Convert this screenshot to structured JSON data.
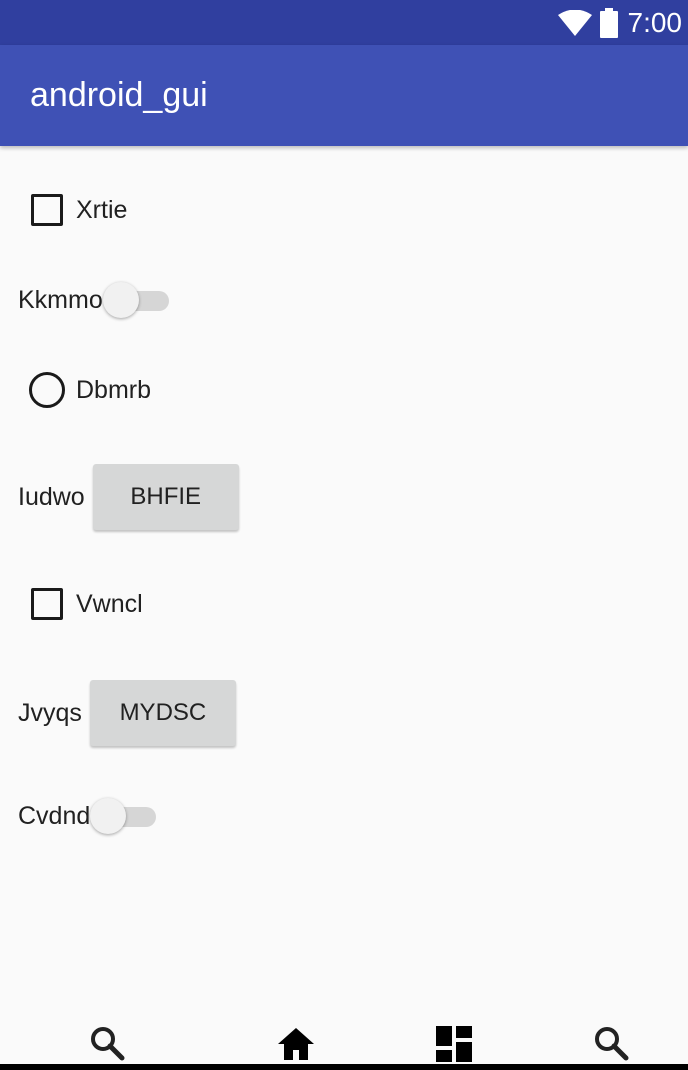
{
  "status_bar": {
    "time": "7:00",
    "wifi_icon": "wifi-icon",
    "battery_icon": "battery-icon"
  },
  "app_bar": {
    "title": "android_gui"
  },
  "rows": {
    "checkbox_1": {
      "label": "Xrtie",
      "checked": false
    },
    "switch_1": {
      "label": "Kkmmo",
      "on": false
    },
    "radio_1": {
      "label": "Dbmrb",
      "selected": false
    },
    "button_row_1": {
      "label": "Iudwo",
      "button": "BHFIE"
    },
    "checkbox_2": {
      "label": "Vwncl",
      "checked": false
    },
    "button_row_2": {
      "label": "Jvyqs",
      "button": "MYDSC"
    },
    "switch_2": {
      "label": "Cvdnd",
      "on": false
    }
  },
  "bottom_nav": {
    "items": [
      "search-icon",
      "home-icon",
      "dashboard-icon",
      "search-icon"
    ]
  },
  "colors": {
    "status_bar": "#303f9f",
    "app_bar": "#3f51b5",
    "background": "#fafafa",
    "button": "#d6d7d7"
  }
}
